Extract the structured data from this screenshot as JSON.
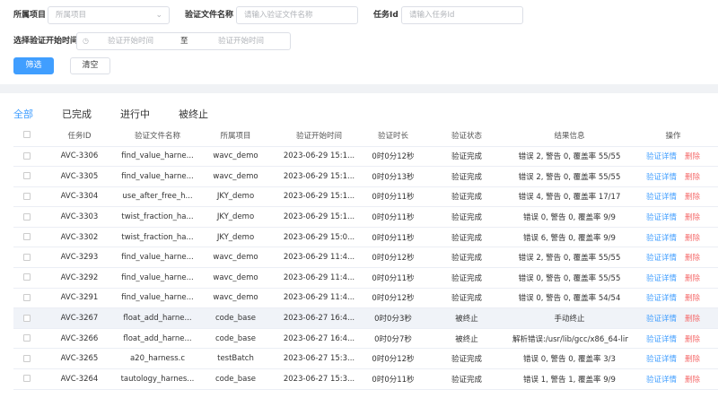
{
  "filters": {
    "project_label": "所属项目",
    "project_placeholder": "所属项目",
    "file_label": "验证文件名称",
    "file_placeholder": "请输入验证文件名称",
    "task_label": "任务Id",
    "task_placeholder": "请输入任务Id",
    "time_label": "选择验证开始时间",
    "time_start_placeholder": "验证开始时间",
    "time_sep": "至",
    "time_end_placeholder": "验证开始时间",
    "search_button": "筛选",
    "clear_button": "清空"
  },
  "tabs": [
    {
      "label": "全部",
      "active": true
    },
    {
      "label": "已完成",
      "active": false
    },
    {
      "label": "进行中",
      "active": false
    },
    {
      "label": "被终止",
      "active": false
    }
  ],
  "table": {
    "headers": {
      "id": "任务ID",
      "file": "验证文件名称",
      "project": "所属项目",
      "start": "验证开始时间",
      "duration": "验证时长",
      "status": "验证状态",
      "result": "结果信息",
      "ops": "操作"
    },
    "detail_label": "验证详情",
    "delete_label": "删除",
    "rows": [
      {
        "id": "AVC-3306",
        "file": "find_value_harne...",
        "project": "wavc_demo",
        "start": "2023-06-29 15:1...",
        "duration": "0时0分12秒",
        "status": "验证完成",
        "result": "错误 2, 警告 0, 覆盖率 55/55"
      },
      {
        "id": "AVC-3305",
        "file": "find_value_harne...",
        "project": "wavc_demo",
        "start": "2023-06-29 15:1...",
        "duration": "0时0分13秒",
        "status": "验证完成",
        "result": "错误 2, 警告 0, 覆盖率 55/55"
      },
      {
        "id": "AVC-3304",
        "file": "use_after_free_h...",
        "project": "JKY_demo",
        "start": "2023-06-29 15:1...",
        "duration": "0时0分11秒",
        "status": "验证完成",
        "result": "错误 4, 警告 0, 覆盖率 17/17"
      },
      {
        "id": "AVC-3303",
        "file": "twist_fraction_ha...",
        "project": "JKY_demo",
        "start": "2023-06-29 15:1...",
        "duration": "0时0分11秒",
        "status": "验证完成",
        "result": "错误 0, 警告 0, 覆盖率 9/9"
      },
      {
        "id": "AVC-3302",
        "file": "twist_fraction_ha...",
        "project": "JKY_demo",
        "start": "2023-06-29 15:0...",
        "duration": "0时0分11秒",
        "status": "验证完成",
        "result": "错误 6, 警告 0, 覆盖率 9/9"
      },
      {
        "id": "AVC-3293",
        "file": "find_value_harne...",
        "project": "wavc_demo",
        "start": "2023-06-29 11:4...",
        "duration": "0时0分12秒",
        "status": "验证完成",
        "result": "错误 2, 警告 0, 覆盖率 55/55"
      },
      {
        "id": "AVC-3292",
        "file": "find_value_harne...",
        "project": "wavc_demo",
        "start": "2023-06-29 11:4...",
        "duration": "0时0分11秒",
        "status": "验证完成",
        "result": "错误 0, 警告 0, 覆盖率 55/55"
      },
      {
        "id": "AVC-3291",
        "file": "find_value_harne...",
        "project": "wavc_demo",
        "start": "2023-06-29 11:4...",
        "duration": "0时0分12秒",
        "status": "验证完成",
        "result": "错误 0, 警告 0, 覆盖率 54/54"
      },
      {
        "id": "AVC-3267",
        "file": "float_add_harne...",
        "project": "code_base",
        "start": "2023-06-27 16:4...",
        "duration": "0时0分3秒",
        "status": "被终止",
        "result": "手动终止"
      },
      {
        "id": "AVC-3266",
        "file": "float_add_harne...",
        "project": "code_base",
        "start": "2023-06-27 16:4...",
        "duration": "0时0分7秒",
        "status": "被终止",
        "result": "解析错误:/usr/lib/gcc/x86_64-lin..."
      },
      {
        "id": "AVC-3265",
        "file": "a20_harness.c",
        "project": "testBatch",
        "start": "2023-06-27 15:3...",
        "duration": "0时0分12秒",
        "status": "验证完成",
        "result": "错误 0, 警告 0, 覆盖率 3/3"
      },
      {
        "id": "AVC-3264",
        "file": "tautology_harnes...",
        "project": "code_base",
        "start": "2023-06-27 15:3...",
        "duration": "0时0分11秒",
        "status": "验证完成",
        "result": "错误 1, 警告 1, 覆盖率 9/9"
      }
    ]
  },
  "colors": {
    "accent": "#409eff",
    "danger": "#f56c6c"
  },
  "icons": {
    "select": "chevron-down-icon",
    "date": "clock-icon",
    "checkbox": "checkbox-icon"
  }
}
